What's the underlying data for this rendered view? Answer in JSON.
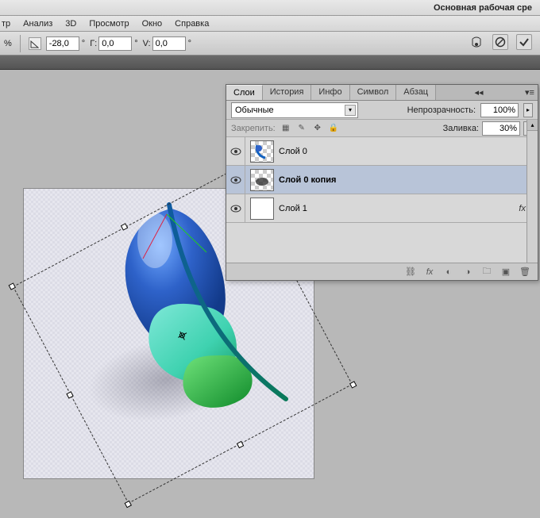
{
  "titlebar": {
    "workspace": "Основная рабочая сре"
  },
  "menu": {
    "items": [
      "тр",
      "Анализ",
      "3D",
      "Просмотр",
      "Окно",
      "Справка"
    ]
  },
  "options": {
    "percent_suffix": "%",
    "angle_value": "-28,0",
    "h_label": "Г:",
    "h_value": "0,0",
    "v_label": "V:",
    "v_value": "0,0"
  },
  "panel": {
    "tabs": [
      "Слои",
      "История",
      "Инфо",
      "Символ",
      "Абзац"
    ],
    "active_tab": 0,
    "blend_label": "Обычные",
    "opacity_label": "Непрозрачность:",
    "opacity_value": "100%",
    "lock_label": "Закрепить:",
    "fill_label": "Заливка:",
    "fill_value": "30%",
    "layers": [
      {
        "name": "Слой 0",
        "visible": true,
        "selected": false,
        "thumb": "feather",
        "fx": false
      },
      {
        "name": "Слой 0 копия",
        "visible": true,
        "selected": true,
        "thumb": "shadow",
        "fx": false
      },
      {
        "name": "Слой 1",
        "visible": true,
        "selected": false,
        "thumb": "white",
        "fx": true
      }
    ],
    "fx_text": "fx"
  }
}
